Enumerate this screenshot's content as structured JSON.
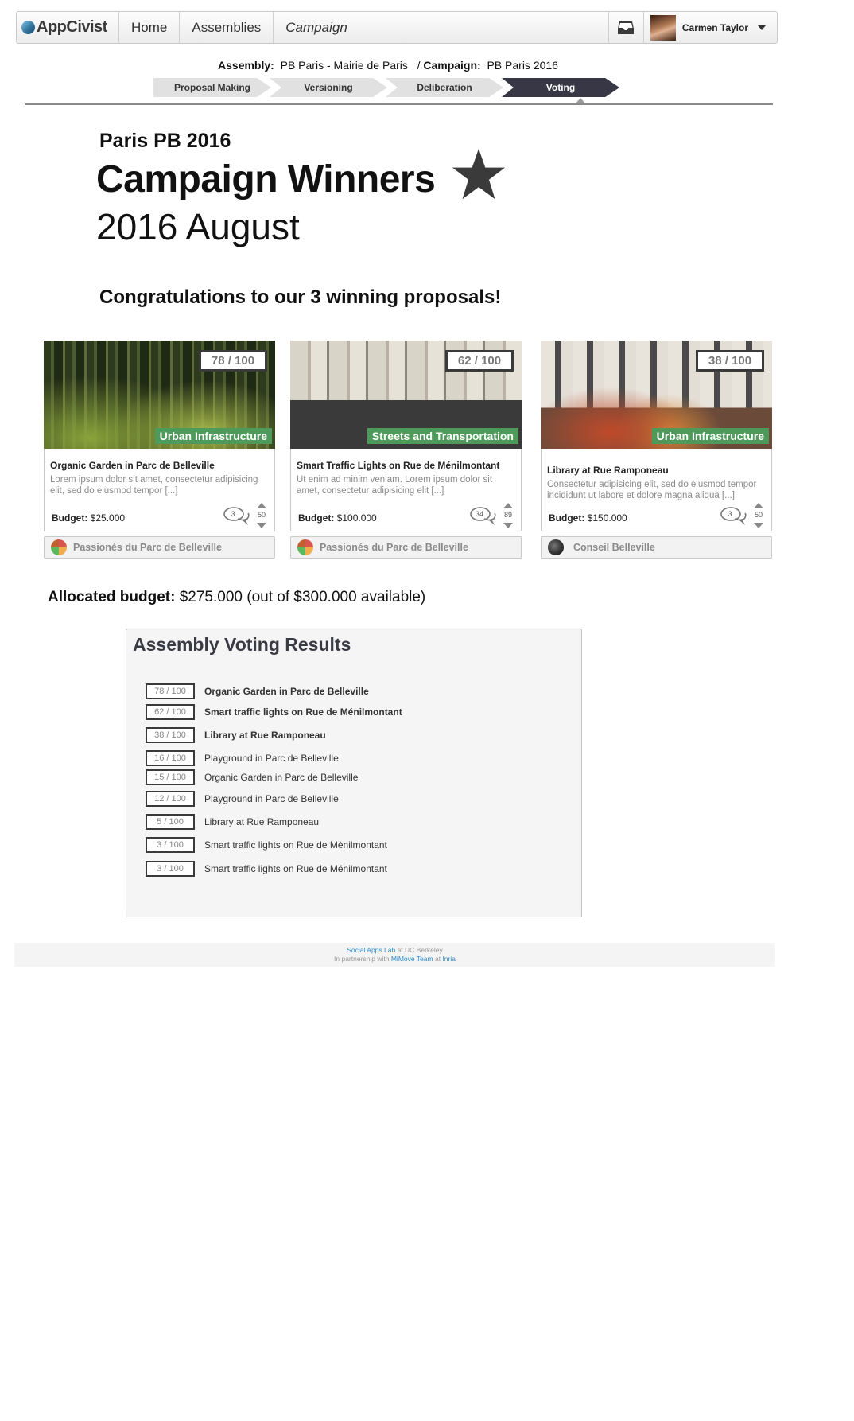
{
  "nav": {
    "logo_text": "AppCivist",
    "home": "Home",
    "assemblies": "Assemblies",
    "campaign": "Campaign",
    "user_name": "Carmen Taylor"
  },
  "breadcrumb": {
    "assembly_label": "Assembly:",
    "assembly_value": "PB Paris - Mairie de Paris",
    "separator": "/",
    "campaign_label": "Campaign:",
    "campaign_value": "PB Paris 2016"
  },
  "stages": [
    {
      "label": "Proposal Making",
      "current": false
    },
    {
      "label": "Versioning",
      "current": false
    },
    {
      "label": "Deliberation",
      "current": false
    },
    {
      "label": "Voting",
      "current": true
    }
  ],
  "header": {
    "campaign_name": "Paris PB 2016",
    "title": "Campaign Winners",
    "subtitle": "2016 August",
    "congrats": "Congratulations to our 3 winning proposals!"
  },
  "cards": [
    {
      "score": "78 / 100",
      "tag": "Urban Infrastructure",
      "title": "Organic Garden in Parc de Belleville",
      "description": "Lorem ipsum dolor sit amet, consectetur adipisicing elit, sed do eiusmod tempor [...]",
      "budget_label": "Budget:",
      "budget_value": "$25.000",
      "comments": "3",
      "votes": "50",
      "group": "Passionés du Parc de Belleville"
    },
    {
      "score": "62 / 100",
      "tag": "Streets and Transportation",
      "title": "Smart Traffic Lights on Rue de Ménilmontant",
      "description": "Ut enim ad minim veniam. Lorem ipsum dolor sit amet, consectetur adipisicing elit [...]",
      "budget_label": "Budget:",
      "budget_value": "$100.000",
      "comments": "34",
      "votes": "89",
      "group": "Passionés du Parc de Belleville"
    },
    {
      "score": "38 / 100",
      "tag": "Urban Infrastructure",
      "title": "Library at Rue Ramponeau",
      "description": "Consectetur adipisicing elit, sed do eiusmod tempor incididunt ut labore et dolore magna aliqua [...]",
      "budget_label": "Budget:",
      "budget_value": "$150.000",
      "comments": "3",
      "votes": "50",
      "group": "Conseil Belleville"
    }
  ],
  "allocated": {
    "label": "Allocated budget:",
    "value": "$275.000 (out of $300.000 available)"
  },
  "results": {
    "title": "Assembly Voting Results",
    "rows": [
      {
        "score": "78 / 100",
        "name": "Organic Garden in Parc de Belleville",
        "winner": true
      },
      {
        "score": "62 / 100",
        "name": "Smart traffic lights on Rue de Ménilmontant",
        "winner": true
      },
      {
        "score": "38 / 100",
        "name": "Library at Rue Ramponeau",
        "winner": true
      },
      {
        "score": "16 / 100",
        "name": "Playground in Parc de Belleville",
        "winner": false
      },
      {
        "score": "15 / 100",
        "name": "Organic Garden in Parc de Belleville",
        "winner": false
      },
      {
        "score": "12 / 100",
        "name": "Playground in Parc de Belleville",
        "winner": false
      },
      {
        "score": "5 / 100",
        "name": "Library at Rue Ramponeau",
        "winner": false
      },
      {
        "score": "3 / 100",
        "name": "Smart traffic lights on Rue de Mènilmontant",
        "winner": false
      },
      {
        "score": "3 / 100",
        "name": "Smart traffic lights on Rue de Ménilmontant",
        "winner": false
      }
    ]
  },
  "footer": {
    "lab_link": "Social Apps Lab",
    "lab_suffix": "at UC Berkeley",
    "partner_prefix": "In partnership with",
    "partner_link": "MiMove Team",
    "partner_at": "at",
    "inria_link": "Inria"
  },
  "colors": {
    "current_stage": "#383746",
    "tag_green": "#4e9a5a",
    "link_blue": "#2a8fcf"
  }
}
